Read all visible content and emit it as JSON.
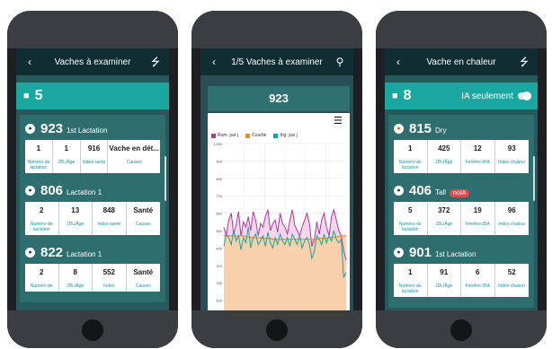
{
  "phone1": {
    "header": {
      "back_icon": "chevron-left-icon",
      "title": "Vaches à examiner",
      "share_icon": "share-icon"
    },
    "count": {
      "icon": "cow-icon",
      "value": "5"
    },
    "cows": [
      {
        "number": "923",
        "sub": "1st Lactation",
        "values": [
          "1",
          "1",
          "916",
          "Vache en dét..."
        ],
        "labels": [
          "Numéro de lactation",
          "JDL/Âge",
          "Index santé",
          "Causes"
        ]
      },
      {
        "number": "806",
        "sub": "Lactation 1",
        "values": [
          "2",
          "13",
          "848",
          "Santé"
        ],
        "labels": [
          "Numéro de lactation",
          "JDL/Âge",
          "Index santé",
          "Causes"
        ]
      },
      {
        "number": "822",
        "sub": "Lactation 1",
        "values": [
          "2",
          "8",
          "552",
          "Santé"
        ],
        "labels": [
          "Numéro de",
          "JDL/Âge",
          "Index",
          "Causes"
        ]
      }
    ]
  },
  "phone2": {
    "header": {
      "back_icon": "chevron-left-icon",
      "title": "1/5 Vaches à examiner",
      "search_icon": "search-icon"
    },
    "cow_number": "923",
    "menu_icon": "list-menu-icon",
    "legend": [
      "Rum. par j",
      "Courbe",
      "Ing. par j"
    ]
  },
  "phone3": {
    "header": {
      "back_icon": "chevron-left-icon",
      "title": "Vache en chaleur",
      "share_icon": "share-icon"
    },
    "count": {
      "icon": "cow-icon",
      "value": "8"
    },
    "ia_toggle_label": "IA seulement",
    "cows": [
      {
        "number": "815",
        "sub": "Dry",
        "badge": "",
        "values": [
          "1",
          "425",
          "12",
          "93"
        ],
        "labels": [
          "Numéro de lactation",
          "JDL/Âge",
          "Fenêtre d'IA",
          "Index chaleur"
        ]
      },
      {
        "number": "406",
        "sub": "Tall",
        "badge": "noIA",
        "values": [
          "5",
          "372",
          "19",
          "96"
        ],
        "labels": [
          "Numéro de lactation",
          "JDL/Âge",
          "Fenêtre d'IA",
          "Index chaleur"
        ]
      },
      {
        "number": "901",
        "sub": "1st Lactation",
        "badge": "",
        "values": [
          "1",
          "91",
          "6",
          "52"
        ],
        "labels": [
          "Numéro de lactation",
          "JDL/Âge",
          "Fenêtre d'IA",
          "Index chaleur"
        ]
      }
    ]
  },
  "colors": {
    "header_bg": "#0f2d33",
    "accent_teal": "#19a7a0",
    "card_area": "#2e6e6f",
    "label_blue": "#1f8fa8",
    "rumination": "#b0399c",
    "curve": "#f08a2a",
    "ingestion": "#1aa59a",
    "noia_red": "#e14b4b"
  },
  "chart_data": {
    "type": "line",
    "title": "",
    "y_ticks": [
      "1,000",
      "900",
      "800",
      "700",
      "600",
      "500",
      "400",
      "300",
      "200",
      "100"
    ],
    "series": [
      {
        "name": "Rum. par j",
        "values": [
          520,
          470,
          560,
          600,
          480,
          530,
          610,
          470,
          550,
          520,
          580,
          500,
          610,
          560,
          470,
          540,
          520,
          580,
          620,
          500,
          540,
          560,
          490,
          600,
          540,
          520,
          480,
          560,
          620,
          530,
          500,
          470,
          520,
          560,
          600,
          540,
          410,
          450,
          550,
          480,
          560,
          600,
          520,
          470,
          580,
          620,
          560,
          500,
          470,
          380,
          330
        ]
      },
      {
        "name": "Courbe",
        "values": [
          470,
          470,
          470,
          470,
          470,
          470,
          470,
          470,
          470,
          465,
          465,
          460,
          460,
          460,
          460,
          460,
          455,
          455,
          455,
          455,
          450,
          450,
          450,
          450,
          450,
          450,
          450,
          450,
          450,
          450,
          450,
          450,
          450,
          450,
          450,
          450,
          450,
          450,
          450,
          455,
          455,
          455,
          455,
          460,
          460,
          460,
          465,
          465,
          470,
          470,
          470
        ]
      },
      {
        "name": "Ing. par j",
        "values": [
          410,
          480,
          460,
          420,
          500,
          440,
          470,
          390,
          460,
          430,
          520,
          400,
          460,
          480,
          420,
          440,
          470,
          410,
          490,
          430,
          400,
          460,
          420,
          480,
          440,
          420,
          460,
          410,
          480,
          450,
          420,
          470,
          400,
          440,
          460,
          420,
          340,
          380,
          470,
          450,
          420,
          480,
          430,
          470,
          440,
          500,
          450,
          430,
          450,
          230,
          260
        ]
      }
    ],
    "ylim": [
      0,
      1000
    ],
    "legend_position": "top"
  }
}
